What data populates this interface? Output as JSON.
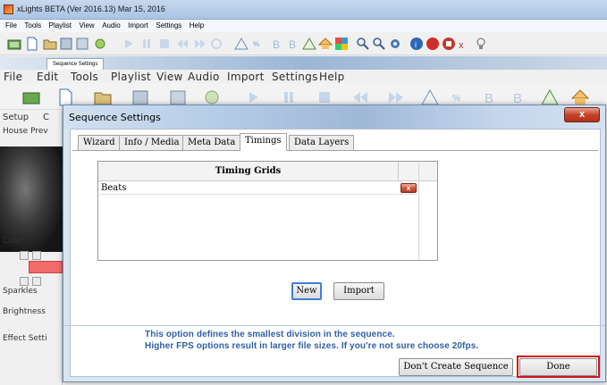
{
  "app": {
    "title": "xLights BETA (Ver 2016.13) Mar 15, 2016",
    "menu": [
      "File",
      "Tools",
      "Playlist",
      "View",
      "Audio",
      "Import",
      "Settings",
      "Help"
    ]
  },
  "inner_window": {
    "tab_title": "Sequence Settings",
    "menu": [
      "File",
      "Edit",
      "Tools",
      "Playlist",
      "View",
      "Audio",
      "Import",
      "Settings",
      "Help"
    ]
  },
  "left_panel": {
    "tab_setup": "Setup",
    "tab_c": "C",
    "house_preview": "House Prev",
    "color_label": "Color",
    "sparkles_label": "Sparkles",
    "brightness_label": "Brightness",
    "effect_settings": "Effect Setti"
  },
  "dialog": {
    "title": "Sequence Settings",
    "close_glyph": "x",
    "tabs": [
      "Wizard",
      "Info / Media",
      "Meta Data",
      "Timings",
      "Data Layers"
    ],
    "active_tab": "Timings",
    "timing_grids": {
      "header": "Timing Grids",
      "rows": [
        {
          "name": "Beats",
          "delete_glyph": "x"
        }
      ]
    },
    "buttons": {
      "new": "New",
      "import": "Import",
      "dont_create": "Don't Create Sequence",
      "done": "Done"
    },
    "info": {
      "line1": "This option defines the smallest division in the sequence.",
      "line2": "Higher FPS options result in larger file sizes. If you're not sure choose 20fps."
    }
  },
  "colors": {
    "accent_blue": "#2d5fa6",
    "highlight_red": "#d11515",
    "dialog_bg": "#d9e5f3"
  }
}
